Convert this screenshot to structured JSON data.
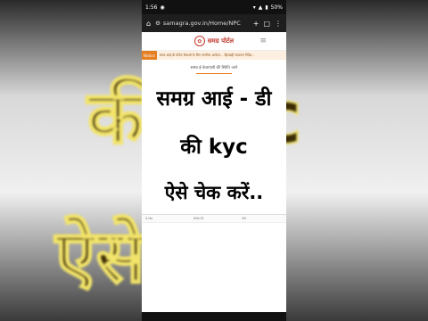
{
  "background": {
    "line1": "कीkyc",
    "line2": "ऐसेकरें.."
  },
  "status_bar": {
    "time": "1:56",
    "battery": "50%"
  },
  "browser": {
    "url": "samagra.gov.in/Home/NPC"
  },
  "site": {
    "title": "समग्र पोर्टल",
    "ticker_label": "Notice",
    "ticker_text": "समग्र आई-डी पोर्टल सेवाओं के लिए नागरिक आवेदन... हितग्राही सत्यापन निर्देश...",
    "section_heading": "समग्र ई-केवायसी की स्थिति जाने"
  },
  "overlay": {
    "line1": "समग्र आई - डी",
    "line2": "की  kyc",
    "line3": "ऐसे चेक करें.."
  },
  "table": {
    "columns": [
      "S.No",
      "समग्र ID",
      "नाम"
    ]
  },
  "colors": {
    "brand_red": "#c0392b",
    "ticker_orange": "#e67e22"
  }
}
